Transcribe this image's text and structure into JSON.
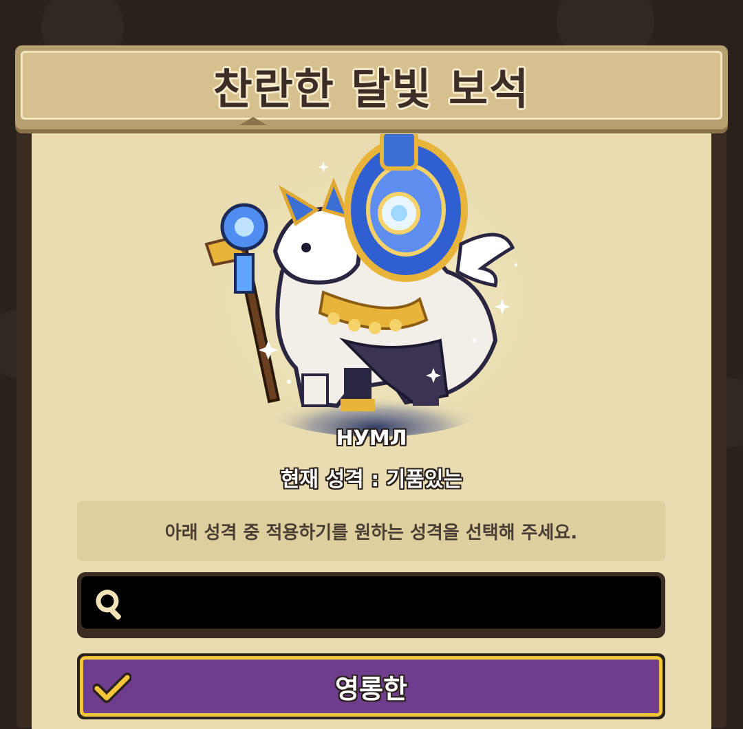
{
  "dialog": {
    "title": "찬란한 달빛 보석"
  },
  "pet": {
    "name": "НУМЛ",
    "current_trait": "현재 성격 : 기품있는"
  },
  "instruction": "아래 성격 중 적용하기를 원하는 성격을 선택해 주세요.",
  "search": {
    "value": "",
    "placeholder": ""
  },
  "options": [
    {
      "label": "영롱한",
      "selected": true
    }
  ],
  "icons": {
    "search": "search-icon",
    "selected": "checkmark-icon"
  },
  "colors": {
    "panel": "#e8dcb0",
    "title_bar": "#d5c08e",
    "option_selected": "#6e3e8c",
    "option_border": "#f3c53a"
  }
}
